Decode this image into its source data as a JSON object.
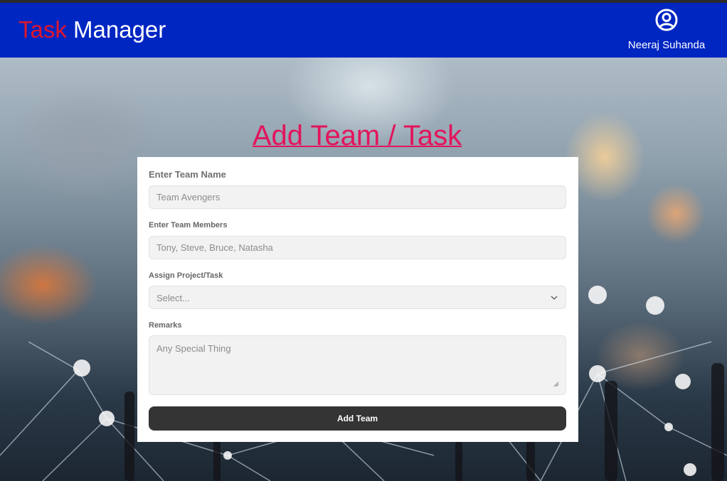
{
  "navbar": {
    "brand_part1": "Task",
    "brand_part2": " Manager",
    "user_name": "Neeraj Suhanda",
    "avatar_icon": "user-circle-icon",
    "bg_color": "#0026c2",
    "accent_color": "#e0162b"
  },
  "page": {
    "title": "Add Team / Task",
    "title_color": "#e3145c"
  },
  "form": {
    "team_name_label": "Enter Team Name",
    "team_name_placeholder": "Team Avengers",
    "members_label": "Enter Team Members",
    "members_placeholder": "Tony, Steve, Bruce, Natasha",
    "assign_label": "Assign Project/Task",
    "assign_selected": "Select...",
    "assign_icon": "chevron-down-icon",
    "remarks_label": "Remarks",
    "remarks_placeholder": "Any Special Thing",
    "submit_label": "Add Team"
  }
}
